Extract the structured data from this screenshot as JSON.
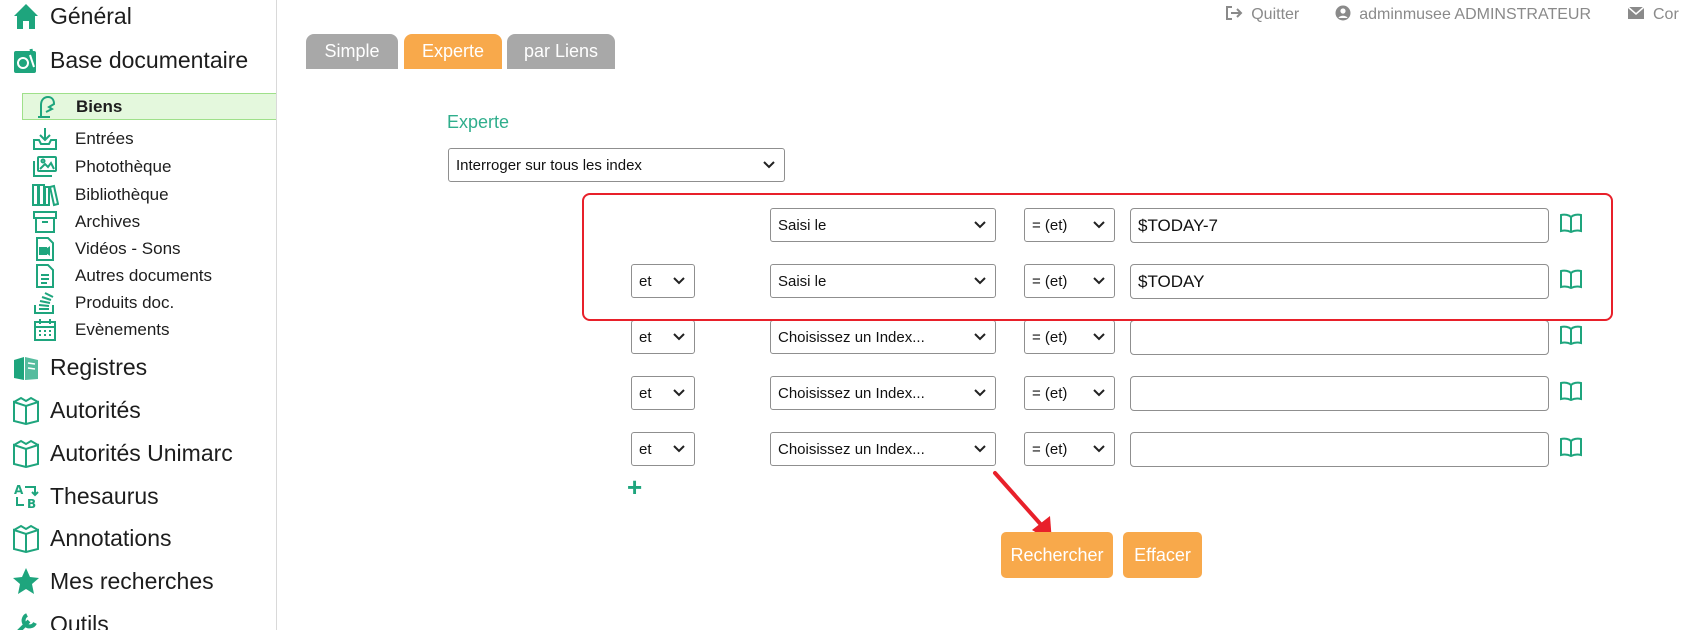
{
  "sidebar": {
    "top_items_1": [
      {
        "label": "Général",
        "icon": "home-icon"
      },
      {
        "label": "Base documentaire",
        "icon": "document-base-icon"
      }
    ],
    "sub_items": [
      {
        "label": "Biens",
        "icon": "object-icon",
        "active": true
      },
      {
        "label": "Entrées",
        "icon": "inbox-download-icon"
      },
      {
        "label": "Photothèque",
        "icon": "images-icon"
      },
      {
        "label": "Bibliothèque",
        "icon": "books-icon"
      },
      {
        "label": "Archives",
        "icon": "archive-box-icon"
      },
      {
        "label": "Vidéos - Sons",
        "icon": "video-file-icon"
      },
      {
        "label": "Autres documents",
        "icon": "document-icon"
      },
      {
        "label": "Produits doc.",
        "icon": "stack-icon"
      },
      {
        "label": "Evènements",
        "icon": "calendar-icon"
      }
    ],
    "top_items_2": [
      {
        "label": "Registres",
        "icon": "registers-icon"
      },
      {
        "label": "Autorités",
        "icon": "book-open-icon"
      },
      {
        "label": "Autorités Unimarc",
        "icon": "book-open-icon"
      },
      {
        "label": "Thesaurus",
        "icon": "thesaurus-icon"
      },
      {
        "label": "Annotations",
        "icon": "book-open-icon"
      },
      {
        "label": "Mes recherches",
        "icon": "star-icon"
      },
      {
        "label": "Outils",
        "icon": "tools-icon"
      }
    ]
  },
  "topbar": {
    "quit_label": "Quitter",
    "user_label": "adminmusee ADMINSTRATEUR",
    "contact_label": "Cor"
  },
  "tabs": [
    "Simple",
    "Experte",
    "par Liens"
  ],
  "active_tab": "Experte",
  "search": {
    "mode_title": "Experte",
    "index_scope": "Interroger sur tous les index",
    "rows": [
      {
        "connector": "",
        "index": "Saisi le",
        "operator": "= (et)",
        "value": "$TODAY-7"
      },
      {
        "connector": "et",
        "index": "Saisi le",
        "operator": "= (et)",
        "value": "$TODAY"
      },
      {
        "connector": "et",
        "index": "Choisissez un Index...",
        "operator": "= (et)",
        "value": ""
      },
      {
        "connector": "et",
        "index": "Choisissez un Index...",
        "operator": "= (et)",
        "value": ""
      },
      {
        "connector": "et",
        "index": "Choisissez un Index...",
        "operator": "= (et)",
        "value": ""
      }
    ],
    "add_row_label": "+",
    "search_button": "Rechercher",
    "clear_button": "Effacer"
  },
  "colors": {
    "accent_green": "#2fae8c",
    "tab_orange": "#f8a94b",
    "tab_gray": "#a8a8a8",
    "highlight_red": "#e8202a",
    "active_item_bg": "#e4f8dd"
  }
}
